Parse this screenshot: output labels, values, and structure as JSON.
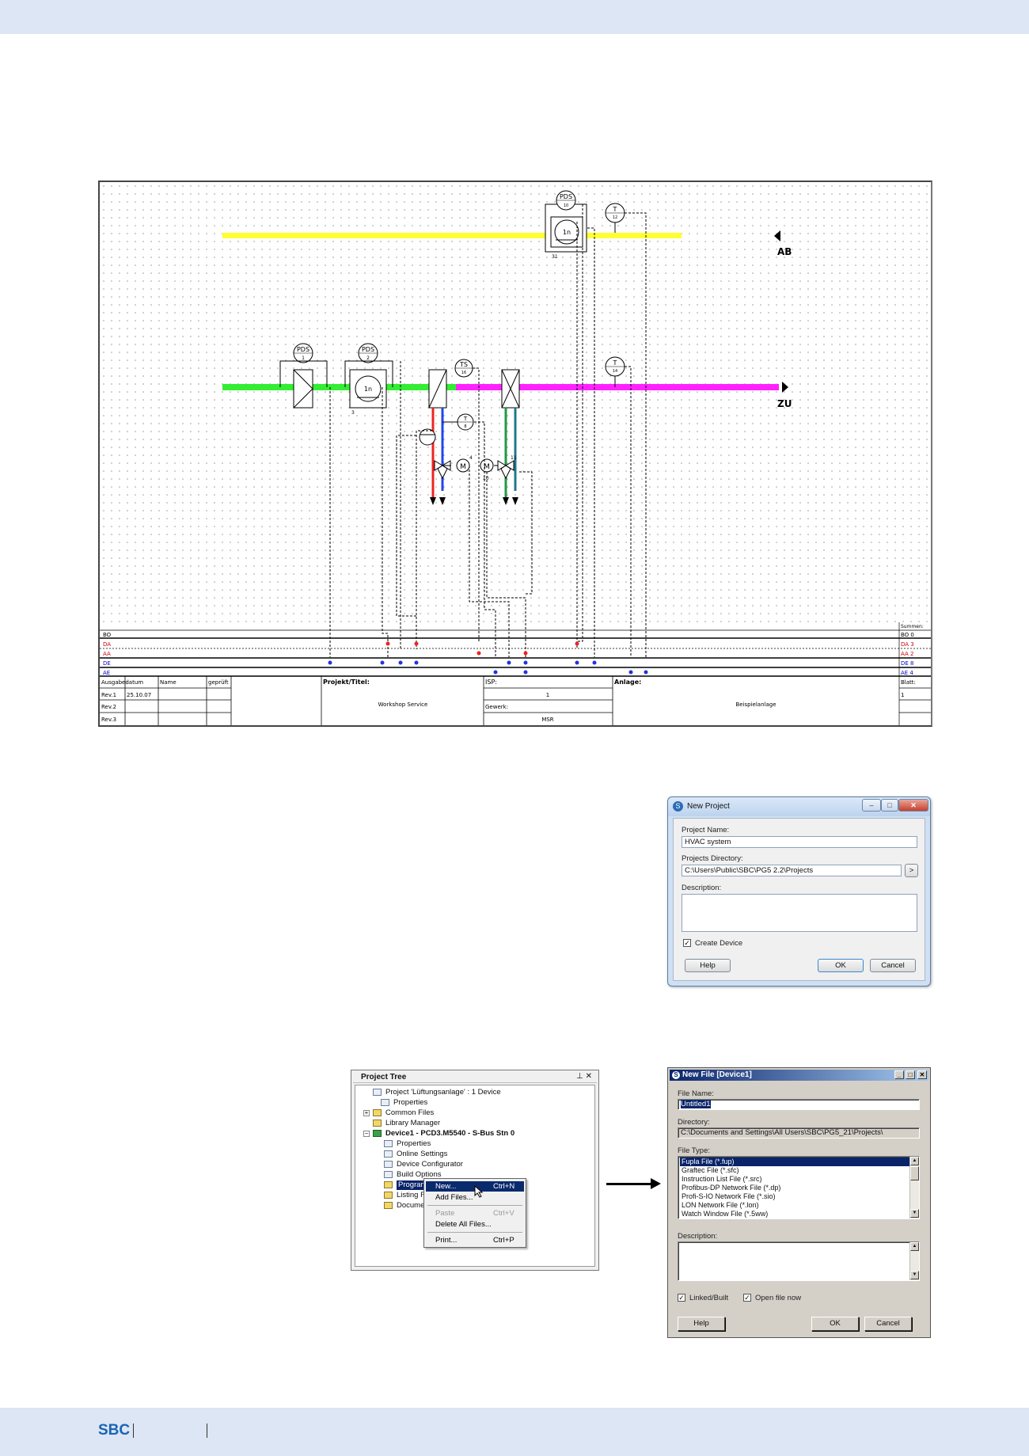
{
  "footer": {
    "brand": "SBC"
  },
  "schematic": {
    "labels": {
      "ab": "AB",
      "zu": "ZU",
      "pds1": "PDS",
      "pds1_num": "1",
      "pds2": "PDS",
      "pds2_num": "2",
      "pds10": "PDS",
      "pds10_num": "10",
      "fan": "1n",
      "fan_tag": "31",
      "fan2_tag": "3",
      "ts": "TS",
      "ts_num": "16",
      "t12": "T",
      "t12_num": "12",
      "t14": "T",
      "t14_num": "14",
      "t_inner": "T",
      "t_inner_num": "8",
      "motor": "M",
      "m_num1": "4",
      "m_num2": "10",
      "m_num3": "11"
    },
    "io_rows": [
      "BO",
      "DA",
      "AA",
      "DE",
      "AE"
    ],
    "io_rows_right": [
      "BO 0",
      "DA 3",
      "AA 2",
      "DE 8",
      "AE 4"
    ],
    "io_right_header": "Summen:",
    "title_block": {
      "col_ausgabe": "Ausgabedatum",
      "col_name": "Name",
      "col_geprueft": "geprüft",
      "rev1": "Rev.1",
      "rev1_date": "25.10.07",
      "rev2": "Rev.2",
      "rev3": "Rev.3",
      "projekt_label": "Projekt/Titel:",
      "projekt_value": "Workshop Service",
      "isp_label": "ISP:",
      "isp_value": "1",
      "gewerk_label": "Gewerk:",
      "gewerk_value": "MSR",
      "anlage_label": "Anlage:",
      "anlage_value": "Beispielanlage",
      "blatt_label": "Blatt:",
      "blatt_value": "1"
    }
  },
  "new_project": {
    "title": "New Project",
    "project_name_label": "Project Name:",
    "project_name_value": "HVAC system",
    "dir_label": "Projects Directory:",
    "dir_value": "C:\\Users\\Public\\SBC\\PG5 2.2\\Projects",
    "dir_browse": ">",
    "desc_label": "Description:",
    "create_device_label": "Create Device",
    "create_device_checked": "✓",
    "help": "Help",
    "ok": "OK",
    "cancel": "Cancel"
  },
  "project_tree": {
    "header": "Project Tree",
    "pin": "⊥ ✕",
    "nodes": [
      "Project 'Lüftungsanlage' : 1 Device",
      "Properties",
      "Common Files",
      "Library Manager",
      "Device1 - PCD3.M5540 - S-Bus Stn 0",
      "Properties",
      "Online Settings",
      "Device Configurator",
      "Build Options",
      "Program",
      "Listing Fil",
      "Documen"
    ],
    "context_menu": {
      "new": "New...",
      "new_acc": "Ctrl+N",
      "add": "Add Files...",
      "paste": "Paste",
      "paste_acc": "Ctrl+V",
      "delete_all": "Delete All Files...",
      "print": "Print...",
      "print_acc": "Ctrl+P"
    }
  },
  "new_file": {
    "title": "New File [Device1]",
    "filename_label": "File Name:",
    "filename_value": "Untitled1",
    "directory_label": "Directory:",
    "directory_value": "C:\\Documents and Settings\\All Users\\SBC\\PG5_21\\Projects\\",
    "filetype_label": "File Type:",
    "filetypes": [
      "Fupla File (*.fup)",
      "Graftec File (*.sfc)",
      "Instruction List File (*.src)",
      "Profibus-DP Network File (*.dp)",
      "Profi-S-IO Network File (*.sio)",
      "LON Network File (*.lon)",
      "Watch Window File (*.5ww)"
    ],
    "desc_label": "Description:",
    "linked_label": "Linked/Built",
    "open_now_label": "Open file now",
    "check": "✓",
    "help": "Help",
    "ok": "OK",
    "cancel": "Cancel"
  }
}
